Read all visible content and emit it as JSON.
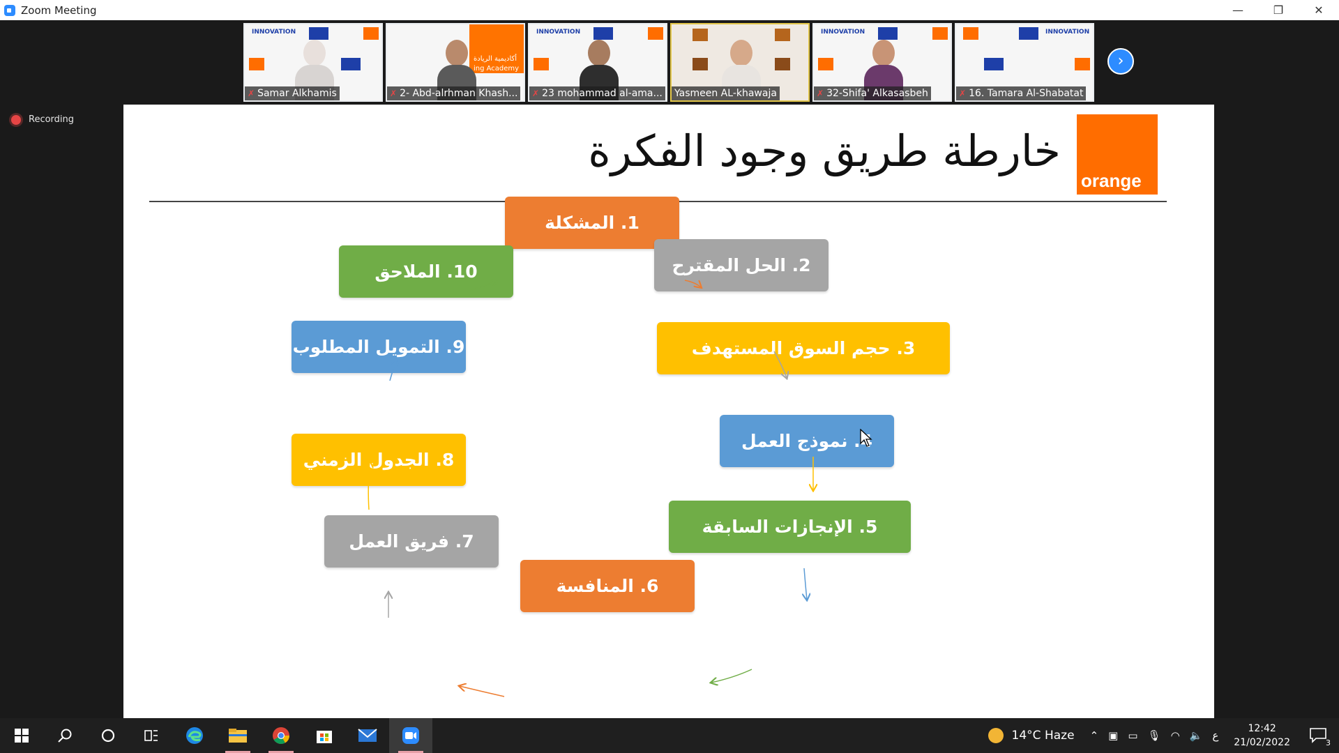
{
  "window": {
    "title": "Zoom Meeting",
    "minimize": "—",
    "restore": "❐",
    "close": "✕"
  },
  "participants": [
    {
      "name": "Samar Alkhamis",
      "muted": true,
      "active": false
    },
    {
      "name": "2- Abd-alrhman Khash...",
      "muted": true,
      "active": false
    },
    {
      "name": "23 mohammad al-ama...",
      "muted": true,
      "active": false
    },
    {
      "name": "Yasmeen AL-khawaja",
      "muted": false,
      "active": true
    },
    {
      "name": "32-Shifa' Alkasasbeh",
      "muted": true,
      "active": false
    },
    {
      "name": "16. Tamara Al-Shabatat",
      "muted": true,
      "active": false
    }
  ],
  "tile_text": {
    "innovation": "INNOVATION",
    "academy": "أكاديمية الريادة",
    "academy_en": "ing Academy"
  },
  "strip_next": "›",
  "recording": {
    "label": "Recording"
  },
  "slide": {
    "title": "خارطة طريق وجود الفكرة",
    "logo_text": "orange",
    "logo_tm": "™",
    "steps": [
      {
        "label": "1. المشكلة",
        "color": "#ed7d31"
      },
      {
        "label": "2. الحل المقترح",
        "color": "#a5a5a5"
      },
      {
        "label": "3. حجم السوق المستهدف",
        "color": "#ffc000"
      },
      {
        "label": "4. نموذج العمل",
        "color": "#5b9bd5"
      },
      {
        "label": "5. الإنجازات السابقة",
        "color": "#70ad47"
      },
      {
        "label": "6. المنافسة",
        "color": "#ed7d31"
      },
      {
        "label": "7. فريق العمل",
        "color": "#a5a5a5"
      },
      {
        "label": "8. الجدول الزمني",
        "color": "#ffc000"
      },
      {
        "label": "9. التمويل المطلوب",
        "color": "#5b9bd5"
      },
      {
        "label": "10. الملاحق",
        "color": "#70ad47"
      }
    ]
  },
  "taskbar": {
    "icons": [
      "start-icon",
      "search-icon",
      "cortana-icon",
      "task-view-icon",
      "edge-icon",
      "file-explorer-icon",
      "chrome-icon",
      "store-icon",
      "mail-icon",
      "zoom-icon"
    ],
    "weather": {
      "temp": "14°C",
      "condition": "Haze"
    },
    "lang": "ع",
    "time": "12:42",
    "date": "21/02/2022",
    "notifications": "3"
  }
}
